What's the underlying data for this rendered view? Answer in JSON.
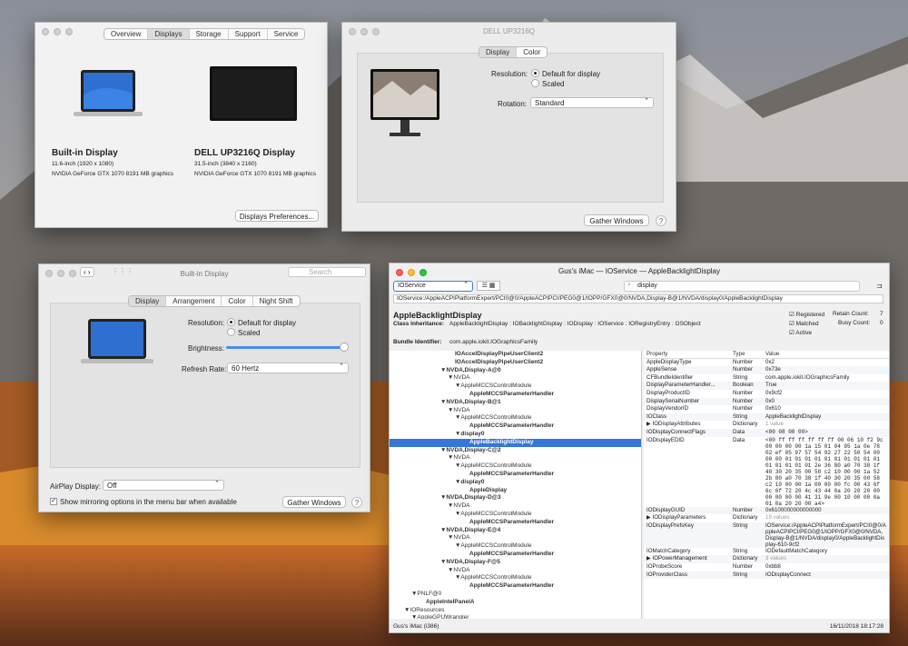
{
  "overview": {
    "tabs": [
      "Overview",
      "Displays",
      "Storage",
      "Support",
      "Service"
    ],
    "active": 1,
    "d1": {
      "name": "Built-in Display",
      "size": "11.6-inch (1920 x 1080)",
      "gpu": "NVIDIA GeForce GTX 1070 8191 MB graphics"
    },
    "d2": {
      "name": "DELL UP3216Q Display",
      "size": "31.5-inch (3840 x 2160)",
      "gpu": "NVIDIA GeForce GTX 1070 8191 MB graphics"
    },
    "button": "Displays Preferences..."
  },
  "dell": {
    "title": "DELL UP3216Q",
    "tabs": [
      "Display",
      "Color"
    ],
    "resolution_label": "Resolution:",
    "opt_default": "Default for display",
    "opt_scaled": "Scaled",
    "rotation_label": "Rotation:",
    "rotation_value": "Standard",
    "gather": "Gather Windows",
    "help": "?"
  },
  "builtin": {
    "title": "Built-in Display",
    "search_placeholder": "Search",
    "tabs": [
      "Display",
      "Arrangement",
      "Color",
      "Night Shift"
    ],
    "resolution_label": "Resolution:",
    "opt_default": "Default for display",
    "opt_scaled": "Scaled",
    "brightness_label": "Brightness:",
    "refresh_label": "Refresh Rate:",
    "refresh_value": "60 Hertz",
    "airplay_label": "AirPlay Display:",
    "airplay_value": "Off",
    "mirroring": "Show mirroring options in the menu bar when available",
    "gather": "Gather Windows",
    "help": "?"
  },
  "ioreg": {
    "title": "Gus's iMac — IOService — AppleBacklightDisplay",
    "plane": "IOService",
    "search": "display",
    "path": "IOService:/AppleACPIPlatformExpert/PCI0@0/AppleACPIPCI/PEG0@1/IOPP/GFX0@0/NVDA,Display-B@1/NVDA/display0/AppleBacklightDisplay",
    "class_name": "AppleBacklightDisplay",
    "inheritance_label": "Class Inheritance:",
    "inheritance": "AppleBacklightDisplay : IOBacklightDisplay : IODisplay : IOService : IORegistryEntry : OSObject",
    "bundle_label": "Bundle Identifier:",
    "bundle": "com.apple.iokit.IOGraphicsFamily",
    "registered": "Registered",
    "matched": "Matched",
    "active": "Active",
    "retain_label": "Retain Count:",
    "retain": "7",
    "busy_label": "Busy Count:",
    "busy": "0",
    "tree": [
      {
        "t": "IOAccelDisplayPipeUserClient2",
        "d": 8,
        "b": true
      },
      {
        "t": "IOAccelDisplayPipeUserClient2",
        "d": 8,
        "b": true
      },
      {
        "t": "▼NVDA,Display-A@0",
        "d": 6,
        "b": true
      },
      {
        "t": "▼NVDA",
        "d": 7
      },
      {
        "t": "▼AppleMCCSControlModule",
        "d": 8
      },
      {
        "t": "AppleMCCSParameterHandler",
        "d": 10,
        "b": true
      },
      {
        "t": "▼NVDA,Display-B@1",
        "d": 6,
        "b": true
      },
      {
        "t": "▼NVDA",
        "d": 7
      },
      {
        "t": "▼AppleMCCSControlModule",
        "d": 8
      },
      {
        "t": "AppleMCCSParameterHandler",
        "d": 10,
        "b": true
      },
      {
        "t": "▼display0",
        "d": 8,
        "b": true
      },
      {
        "t": "AppleBacklightDisplay",
        "d": 10,
        "b": true,
        "s": true
      },
      {
        "t": "▼NVDA,Display-C@2",
        "d": 6,
        "b": true
      },
      {
        "t": "▼NVDA",
        "d": 7
      },
      {
        "t": "▼AppleMCCSControlModule",
        "d": 8
      },
      {
        "t": "AppleMCCSParameterHandler",
        "d": 10,
        "b": true
      },
      {
        "t": "▼display0",
        "d": 8,
        "b": true
      },
      {
        "t": "AppleDisplay",
        "d": 10,
        "b": true
      },
      {
        "t": "▼NVDA,Display-D@3",
        "d": 6,
        "b": true
      },
      {
        "t": "▼NVDA",
        "d": 7
      },
      {
        "t": "▼AppleMCCSControlModule",
        "d": 8
      },
      {
        "t": "AppleMCCSParameterHandler",
        "d": 10,
        "b": true
      },
      {
        "t": "▼NVDA,Display-E@4",
        "d": 6,
        "b": true
      },
      {
        "t": "▼NVDA",
        "d": 7
      },
      {
        "t": "▼AppleMCCSControlModule",
        "d": 8
      },
      {
        "t": "AppleMCCSParameterHandler",
        "d": 10,
        "b": true
      },
      {
        "t": "▼NVDA,Display-F@5",
        "d": 6,
        "b": true
      },
      {
        "t": "▼NVDA",
        "d": 7
      },
      {
        "t": "▼AppleMCCSControlModule",
        "d": 8
      },
      {
        "t": "AppleMCCSParameterHandler",
        "d": 10,
        "b": true
      },
      {
        "t": "▼PNLF@0",
        "d": 2
      },
      {
        "t": "AppleIntelPanelA",
        "d": 4,
        "b": true
      },
      {
        "t": "▼IOResources",
        "d": 1
      },
      {
        "t": "▼AppleGPUWrangler",
        "d": 2
      }
    ],
    "cols": [
      "Property",
      "Type",
      "Value"
    ],
    "props": [
      [
        "AppleDisplayType",
        "Number",
        "0x2"
      ],
      [
        "AppleSense",
        "Number",
        "0x73e"
      ],
      [
        "CFBundleIdentifier",
        "String",
        "com.apple.iokit.IOGraphicsFamily"
      ],
      [
        "DisplayParameterHandler...",
        "Boolean",
        "True"
      ],
      [
        "DisplayProductID",
        "Number",
        "0x9cf2"
      ],
      [
        "DisplaySerialNumber",
        "Number",
        "0x0"
      ],
      [
        "DisplayVendorID",
        "Number",
        "0x610"
      ],
      [
        "IOClass",
        "String",
        "AppleBacklightDisplay"
      ],
      [
        "▶ IODisplayAttributes",
        "Dictionary",
        "1 value"
      ],
      [
        "IODisplayConnectFlags",
        "Data",
        "<00 08 00 00>"
      ],
      [
        "IODisplayEDID",
        "Data",
        "<00 ff ff ff ff ff ff 00 06 10 f2 9c 00 00 00 00 1a 15 01 04 95 1a 0e 78 02 ef 05 97 57 54 92 27 22 50 54 00 00 00 01 01 01 01 01 01 01 01 01 01 01 01 01 01 01 2e 36 80 a0 70 38 1f 40 30 20 35 00 58 c2 10 00 00 1a 52 2b 80 a0 70 38 1f 40 30 20 35 00 58 c2 10 00 00 1a 00 00 00 fc 00 43 6f 6c 6f 72 20 4c 43 44 0a 20 20 20 00 00 00 00 00 41 31 9e 00 10 00 00 0a 01 0a 20 20 00 a4>"
      ],
      [
        "IODisplayGUID",
        "Number",
        "0x6100000000000000"
      ],
      [
        "▶ IODisplayParameters",
        "Dictionary",
        "19 values"
      ],
      [
        "IODisplayPrefsKey",
        "String",
        "IOService:/AppleACPIPlatformExpert/PCI0@0/AppleACPIPCI/PEG0@1/IOPP/GFX0@0/NVDA,Display-B@1/NVDA/display0/AppleBacklightDisplay-610-9cf2"
      ],
      [
        "IOMatchCategory",
        "String",
        "IODefaultMatchCategory"
      ],
      [
        "▶ IOPowerManagement",
        "Dictionary",
        "3 values"
      ],
      [
        "IOProbeScore",
        "Number",
        "0xbb8"
      ],
      [
        "IOProviderClass",
        "String",
        "IODisplayConnect"
      ]
    ],
    "status_left": "Gus's iMac (i386)",
    "status_right": "16/11/2018 18:17:28"
  }
}
